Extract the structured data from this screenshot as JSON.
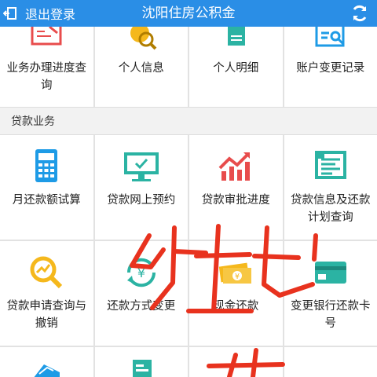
{
  "header": {
    "back_label": "退出登录",
    "title": "沈阳住房公积金"
  },
  "top_row": [
    {
      "label": "业务办理进度查询",
      "icon": "progress-query-icon"
    },
    {
      "label": "个人信息",
      "icon": "person-info-icon"
    },
    {
      "label": "个人明细",
      "icon": "personal-detail-icon"
    },
    {
      "label": "账户变更记录",
      "icon": "account-change-icon"
    }
  ],
  "loan_section": {
    "heading": "贷款业务",
    "row1": [
      {
        "label": "月还款额试算",
        "icon": "calculator-icon"
      },
      {
        "label": "贷款网上预约",
        "icon": "online-appointment-icon"
      },
      {
        "label": "贷款审批进度",
        "icon": "approval-progress-icon"
      },
      {
        "label": "贷款信息及还款计划查询",
        "icon": "loan-plan-icon"
      }
    ],
    "row2": [
      {
        "label": "贷款申请查询与撤销",
        "icon": "application-search-icon"
      },
      {
        "label": "还款方式变更",
        "icon": "repayment-change-icon"
      },
      {
        "label": "现金还款",
        "icon": "cash-repayment-icon"
      },
      {
        "label": "变更银行还款卡号",
        "icon": "bank-card-change-icon"
      }
    ],
    "row3": [
      {
        "icon": "partial-tile-icon"
      },
      {
        "icon": "partial-document-icon"
      },
      {
        "icon": ""
      },
      {
        "icon": ""
      }
    ]
  },
  "colors": {
    "header_bg": "#2a8ee6",
    "icon_blue": "#1e9be6",
    "icon_teal": "#2bb3a3",
    "icon_red": "#e84c4c",
    "icon_yellow": "#f5b81c",
    "scribble": "#e8321e"
  }
}
